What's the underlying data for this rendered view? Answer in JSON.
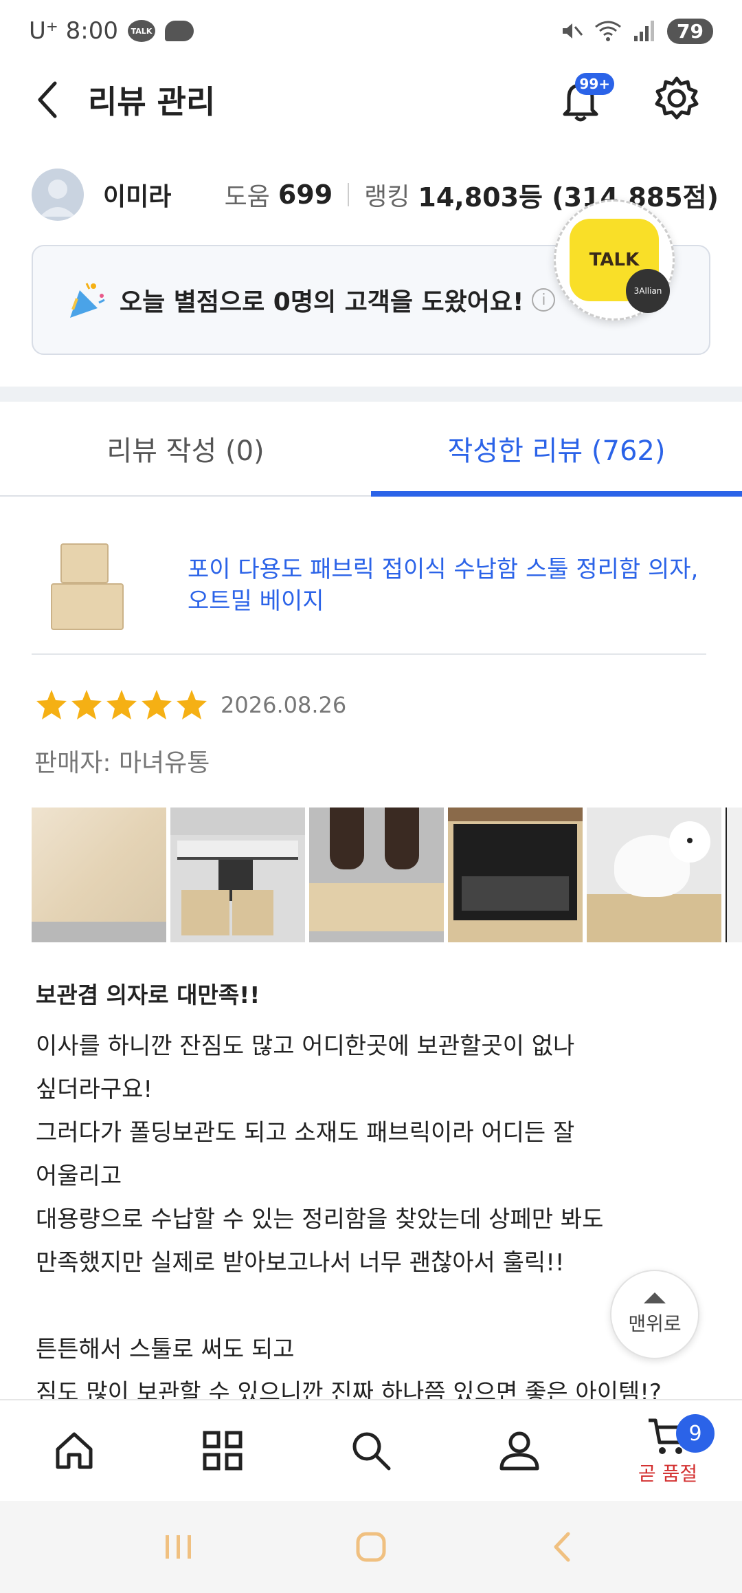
{
  "status_bar": {
    "carrier_time": "U⁺ 8:00",
    "talk_icon": "TALK",
    "battery": "79"
  },
  "header": {
    "title": "리뷰 관리",
    "notification_badge": "99+"
  },
  "profile": {
    "name": "이미라",
    "help_label": "도움",
    "help_count": "699",
    "ranking_label": "랭킹",
    "ranking_value": "14,803등 (314,885점)"
  },
  "banner": {
    "text": "오늘 별점으로 0명의 고객을 도왔어요!",
    "info": "i"
  },
  "talk_float": {
    "label": "TALK",
    "mini_label": "3Allian"
  },
  "tabs": [
    {
      "label": "리뷰 작성 (0)",
      "active": false
    },
    {
      "label": "작성한 리뷰 (762)",
      "active": true
    }
  ],
  "product": {
    "name": "포이 다용도 패브릭 접이식 수납함 스툴 정리함 의자, 오트밀 베이지"
  },
  "review": {
    "rating": 5,
    "date": "2026.08.26",
    "seller": "판매자: 마녀유통",
    "title": "보관겸 의자로 대만족!!",
    "body": "이사를 하니깐 잔짐도 많고 어디한곳에 보관할곳이 없나\n싶더라구요!\n그러다가 폴딩보관도 되고 소재도 패브릭이라 어디든 잘\n어울리고\n대용량으로 수납할 수 있는 정리함을 찾았는데 상페만 봐도\n만족했지만 실제로 받아보고나서 너무 괜찮아서 훌릭!!\n\n튼튼해서 스툴로 써도 되고\n짐도 많이 보관할 수 있으니깐 진짜 하나쯤 있으면 좋은 아이템!?"
  },
  "top_button": {
    "label": "맨위로"
  },
  "bottom_nav": {
    "cart_count": "9",
    "cart_label": "곧 품절"
  },
  "colors": {
    "accent": "#2b63e8",
    "star": "#f5b014",
    "sold_out": "#d32f2f",
    "system_nav": "#f0c080"
  },
  "icons": [
    "back-arrow-icon",
    "bell-icon",
    "gear-icon",
    "home-icon",
    "grid-icon",
    "search-icon",
    "person-icon",
    "cart-icon"
  ]
}
